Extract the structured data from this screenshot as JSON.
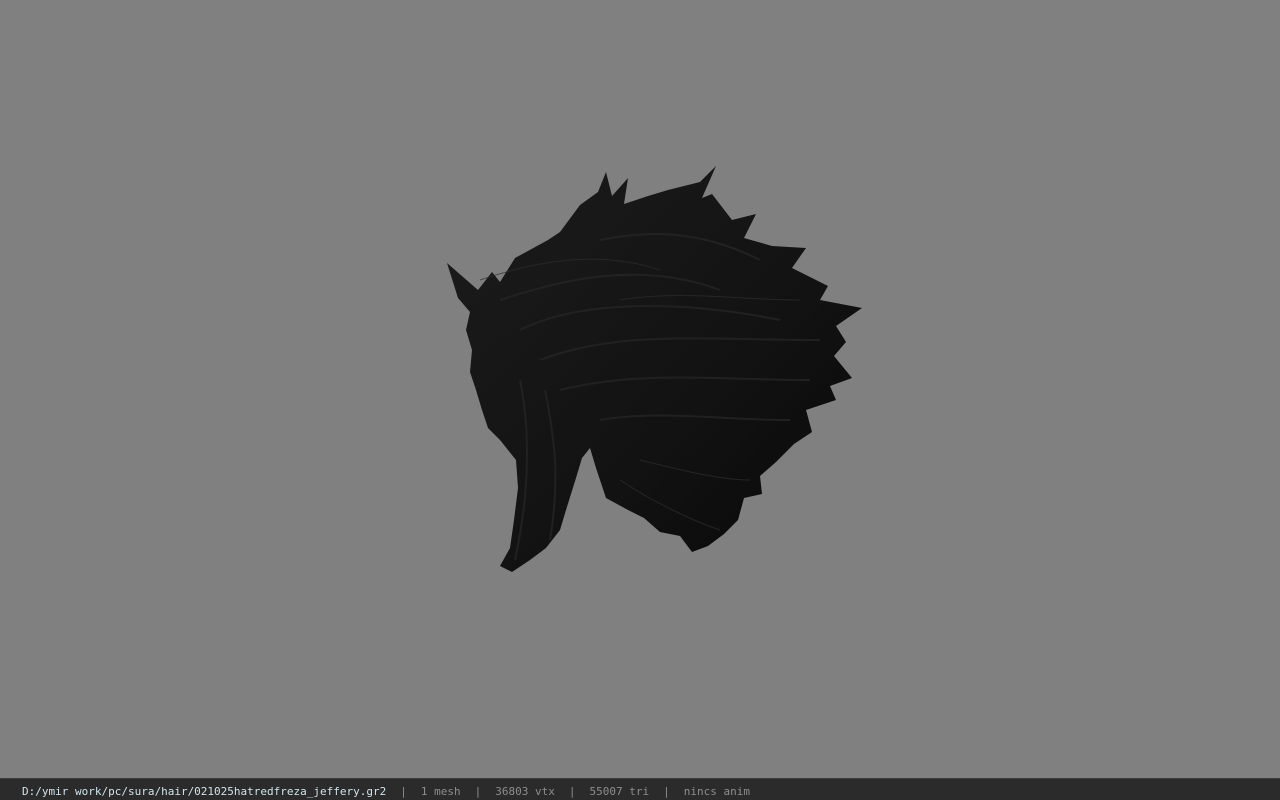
{
  "viewport": {
    "background": "#808080",
    "model_color": "#111111"
  },
  "status_bar": {
    "file_path": "D:/ymir work/pc/sura/hair/021025hatredfreza_jeffery.gr2",
    "separator": "|",
    "mesh_count": "1 mesh",
    "vertex_count": "36803 vtx",
    "triangle_count": "55007 tri",
    "anim_status": "nincs anim"
  }
}
